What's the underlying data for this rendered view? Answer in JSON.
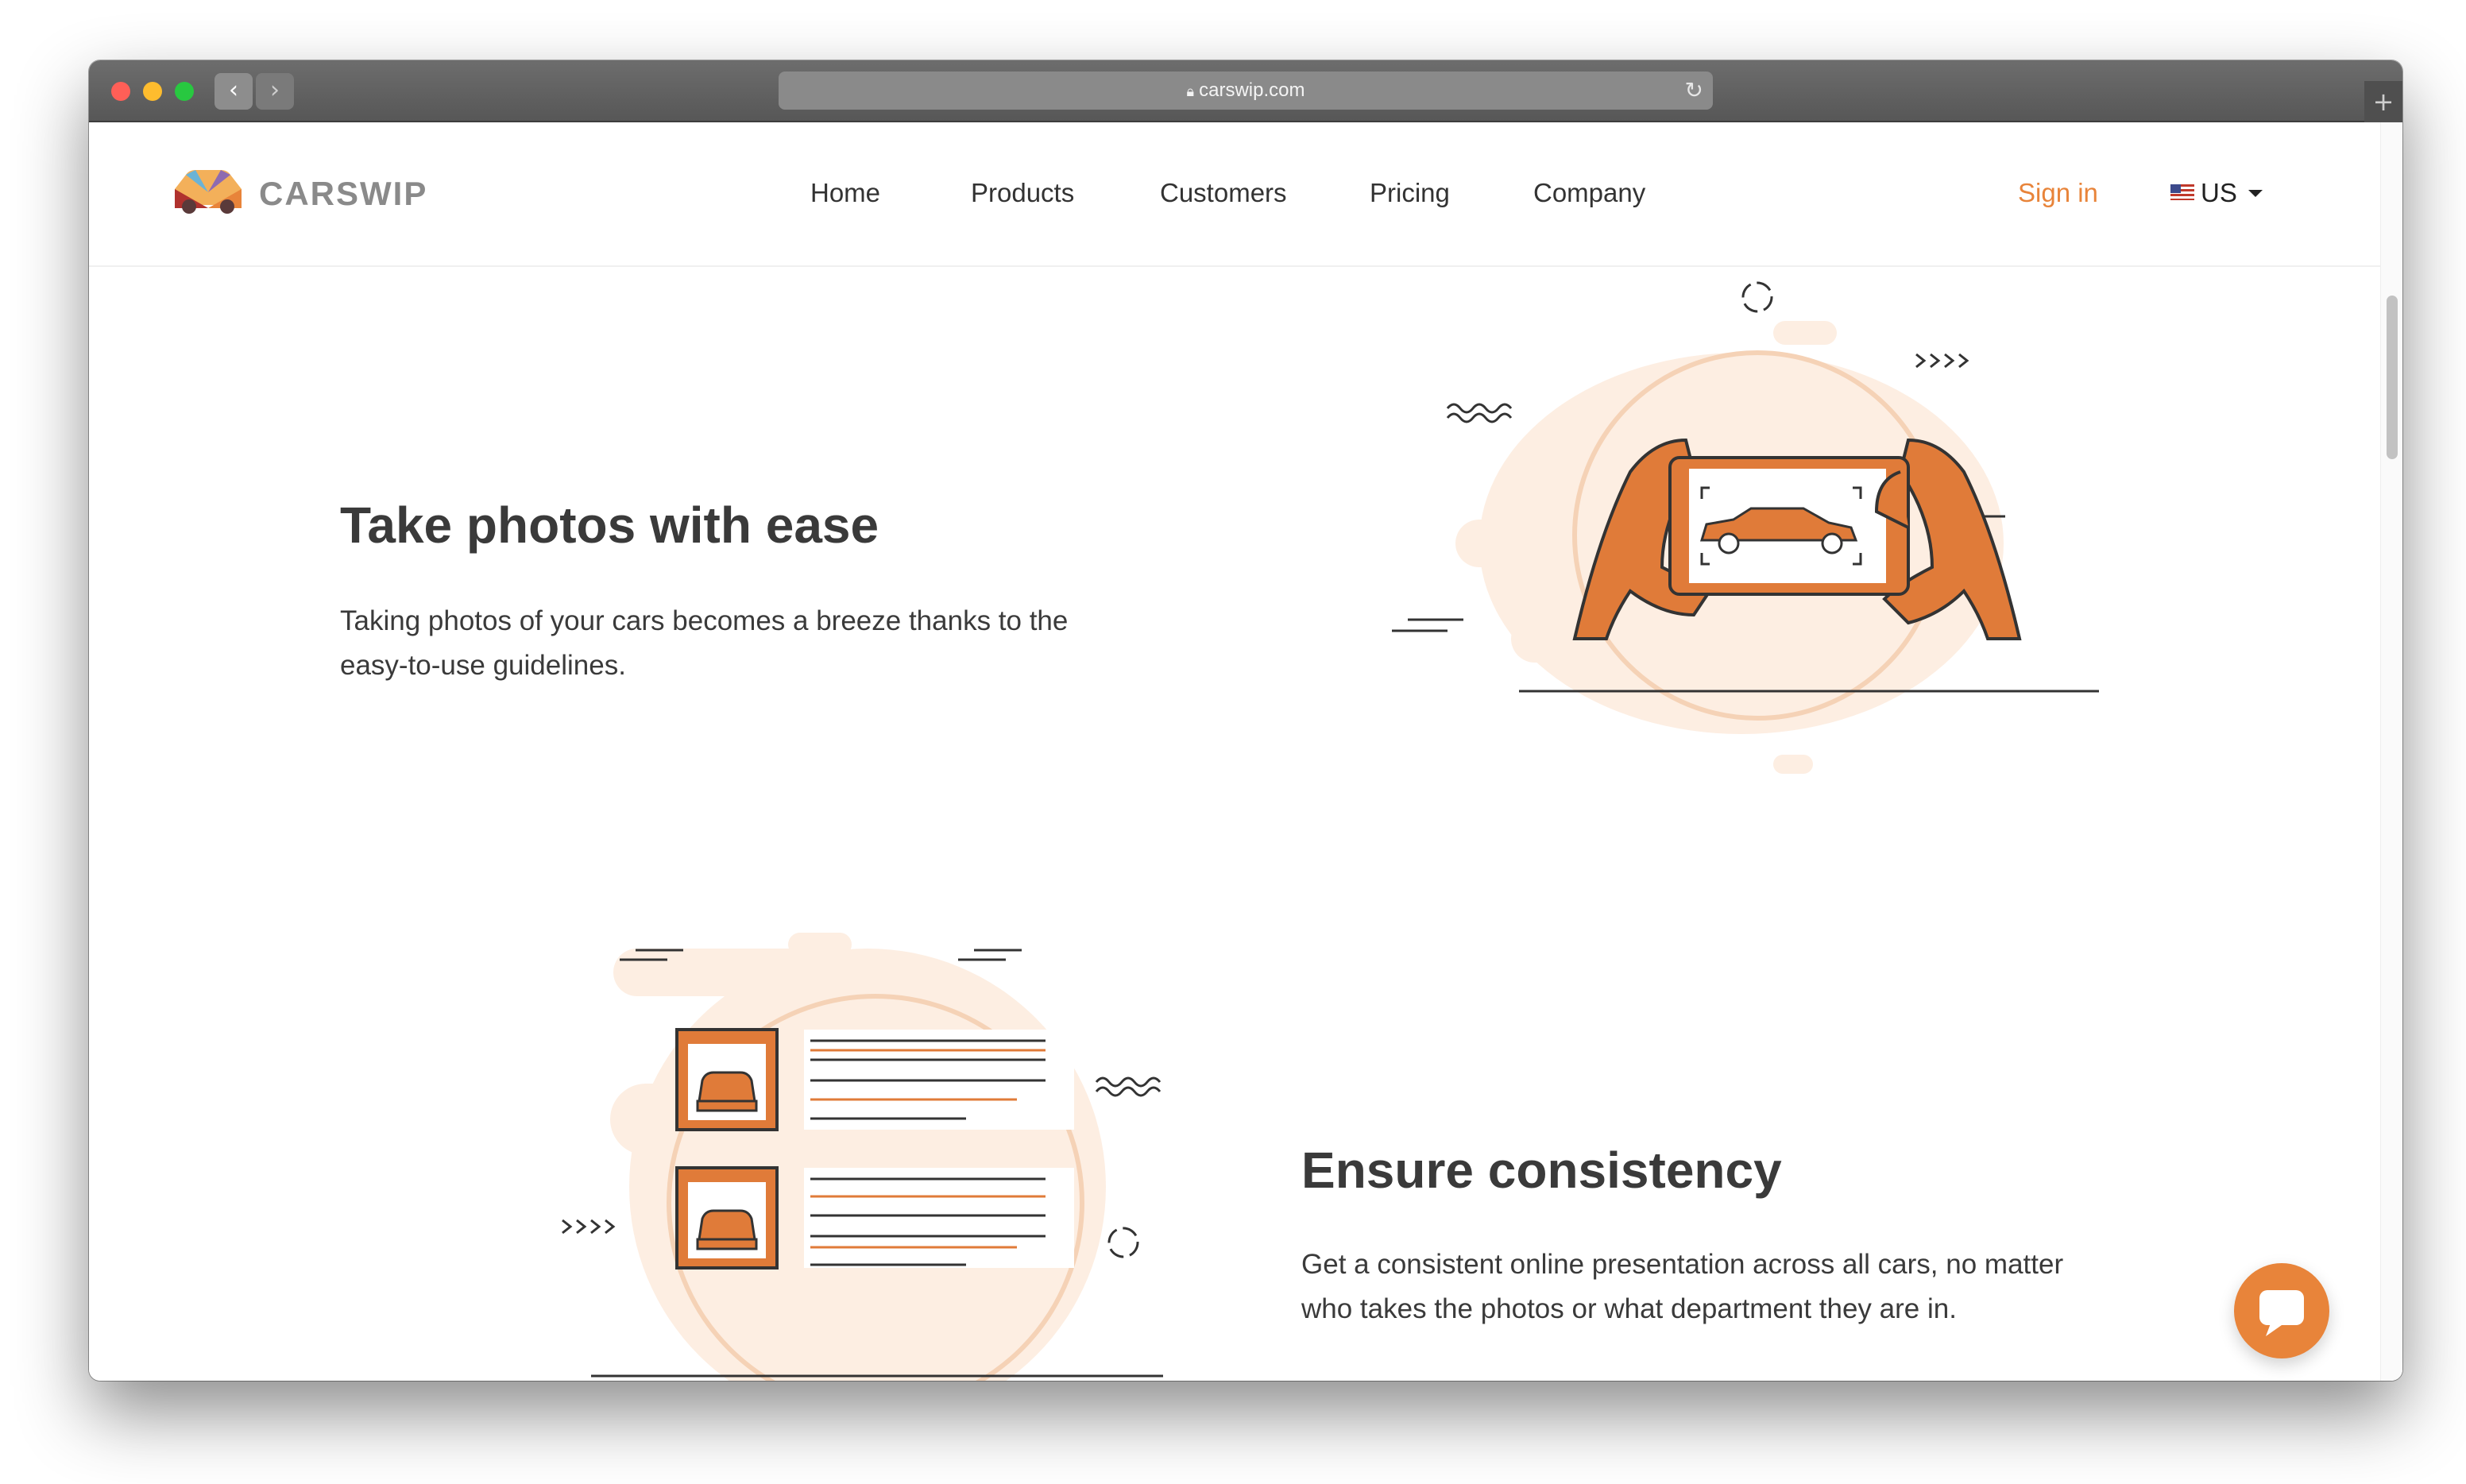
{
  "browser": {
    "url": "carswip.com"
  },
  "brand": {
    "name": "CARSWIP",
    "accent": "#e8843a"
  },
  "nav": {
    "items": [
      "Home",
      "Products",
      "Customers",
      "Pricing",
      "Company"
    ],
    "sign_in": "Sign in",
    "locale": "US"
  },
  "features": [
    {
      "title": "Take photos with ease",
      "line1": "Taking photos of your cars becomes a breeze thanks to the",
      "line2": "easy-to-use guidelines."
    },
    {
      "title": "Ensure consistency",
      "line1": "Get a consistent online presentation across all cars, no matter",
      "line2": "who takes the photos or what department they are in."
    }
  ],
  "icons": [
    "lock-icon",
    "reload-icon",
    "back-icon",
    "forward-icon",
    "new-tab-icon",
    "us-flag-icon",
    "chat-icon"
  ]
}
